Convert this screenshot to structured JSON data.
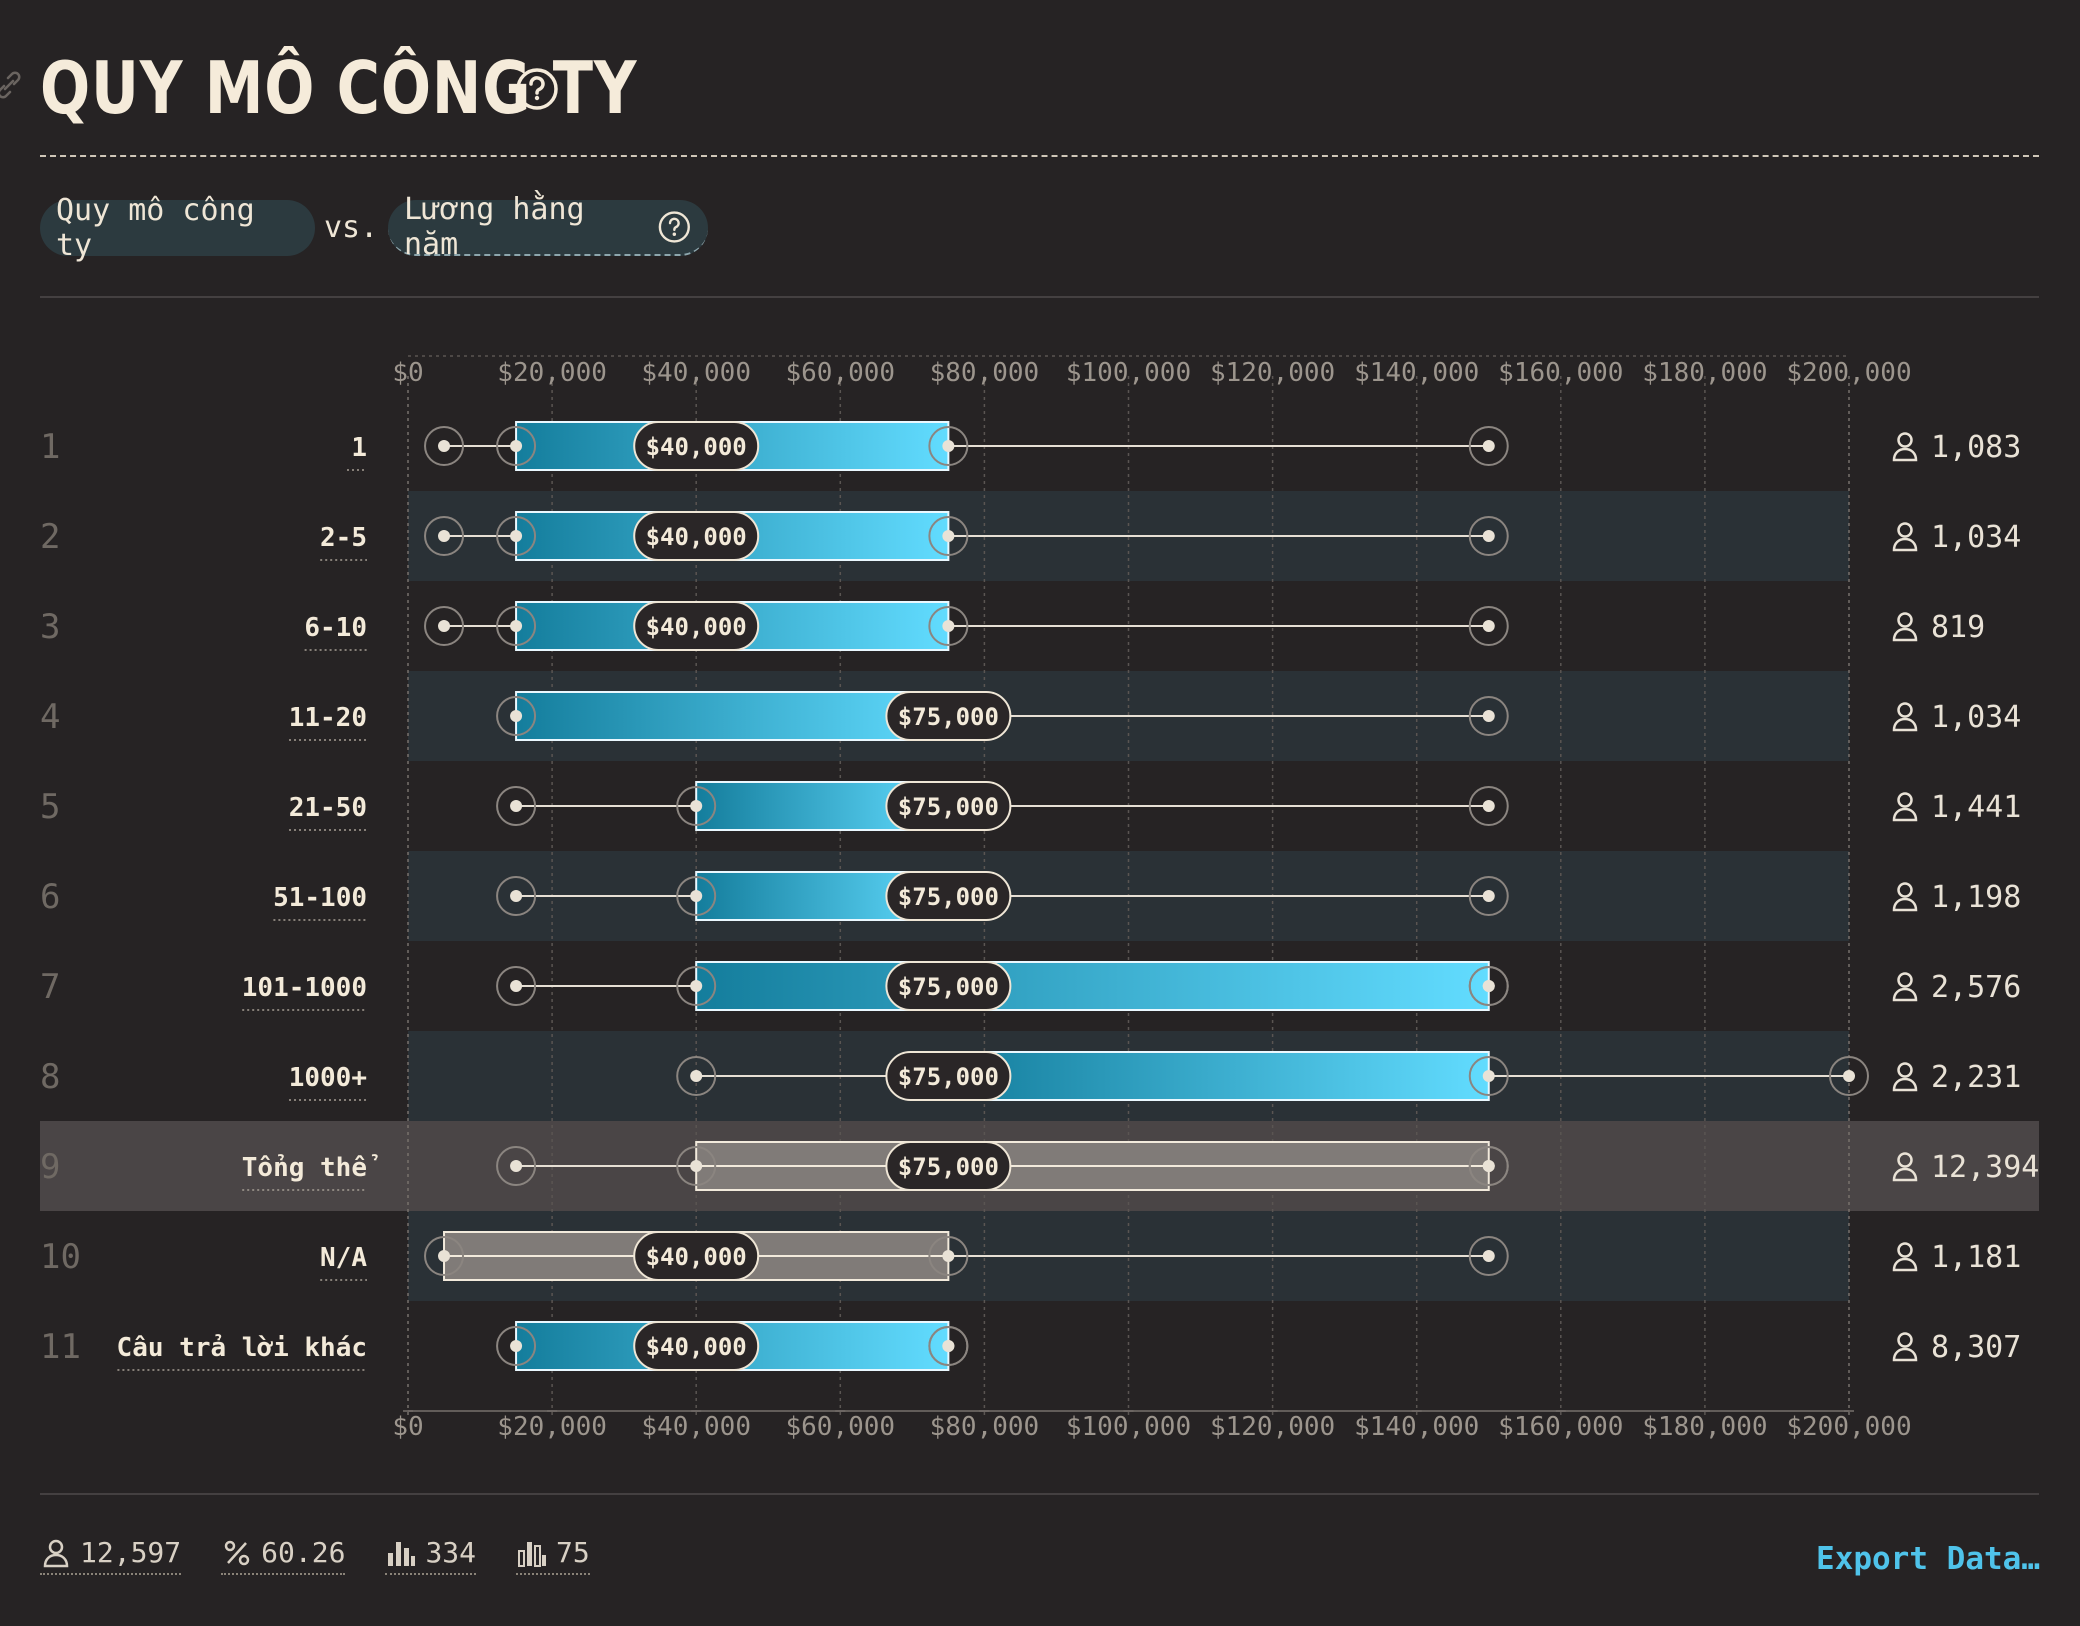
{
  "header": {
    "title": "QUY MÔ CÔNG TY"
  },
  "selector": {
    "primary": "Quy mô công ty",
    "vs": "vs.",
    "secondary": "Lương hằng năm"
  },
  "chart_data": {
    "type": "box",
    "x_ticks": [
      "$0",
      "$20,000",
      "$40,000",
      "$60,000",
      "$80,000",
      "$100,000",
      "$120,000",
      "$140,000",
      "$160,000",
      "$180,000",
      "$200,000"
    ],
    "xlim": [
      0,
      200000
    ],
    "grid": true,
    "rows": [
      {
        "index": "1",
        "label": "1",
        "min": 5000,
        "p10": 15000,
        "q1": 15000,
        "median": 40000,
        "q3": 75000,
        "max": 150000,
        "count": "1,083",
        "style": "blue"
      },
      {
        "index": "2",
        "label": "2-5",
        "min": 5000,
        "p10": 15000,
        "q1": 15000,
        "median": 40000,
        "q3": 75000,
        "max": 150000,
        "count": "1,034",
        "style": "blue"
      },
      {
        "index": "3",
        "label": "6-10",
        "min": 5000,
        "p10": 15000,
        "q1": 15000,
        "median": 40000,
        "q3": 75000,
        "max": 150000,
        "count": "819",
        "style": "blue"
      },
      {
        "index": "4",
        "label": "11-20",
        "min": 15000,
        "p10": 15000,
        "q1": 15000,
        "median": 75000,
        "q3": 75000,
        "max": 150000,
        "count": "1,034",
        "style": "blue"
      },
      {
        "index": "5",
        "label": "21-50",
        "min": 15000,
        "p10": 40000,
        "q1": 40000,
        "median": 75000,
        "q3": 75000,
        "max": 150000,
        "count": "1,441",
        "style": "blue"
      },
      {
        "index": "6",
        "label": "51-100",
        "min": 15000,
        "p10": 40000,
        "q1": 40000,
        "median": 75000,
        "q3": 75000,
        "max": 150000,
        "count": "1,198",
        "style": "blue"
      },
      {
        "index": "7",
        "label": "101-1000",
        "min": 15000,
        "p10": 40000,
        "q1": 40000,
        "median": 75000,
        "q3": 150000,
        "max": 150000,
        "count": "2,576",
        "style": "blue"
      },
      {
        "index": "8",
        "label": "1000+",
        "min": 40000,
        "p10": 40000,
        "q1": 75000,
        "median": 75000,
        "q3": 150000,
        "max": 200000,
        "count": "2,231",
        "style": "blue"
      },
      {
        "index": "9",
        "label": "Tổng thể",
        "min": 15000,
        "p10": 40000,
        "q1": 40000,
        "median": 75000,
        "q3": 150000,
        "max": 150000,
        "count": "12,394",
        "style": "gray"
      },
      {
        "index": "10",
        "label": "N/A",
        "min": 5000,
        "p10": 5000,
        "q1": 5000,
        "median": 40000,
        "q3": 75000,
        "max": 150000,
        "count": "1,181",
        "style": "gray"
      },
      {
        "index": "11",
        "label": "Câu trả lời khác",
        "min": 15000,
        "p10": 15000,
        "q1": 15000,
        "median": 40000,
        "q3": 75000,
        "max": 75000,
        "count": "8,307",
        "style": "blue"
      }
    ],
    "median_labels": [
      "$40,000",
      "$40,000",
      "$40,000",
      "$75,000",
      "$75,000",
      "$75,000",
      "$75,000",
      "$75,000",
      "$75,000",
      "$40,000",
      "$40,000"
    ]
  },
  "footer": {
    "respondents": "12,597",
    "percent": "60.26",
    "bars_count": "334",
    "bins_count": "75",
    "export_label": "Export Data…"
  },
  "colors": {
    "accent": "#4fc3ea",
    "box_dark": "#147d9c",
    "box_light": "#62dcff"
  },
  "icons": {
    "title_help": "question-circle-icon",
    "link": "link-icon",
    "person": "person-icon",
    "percent": "percent-icon",
    "bars": "bar-chart-icon"
  }
}
